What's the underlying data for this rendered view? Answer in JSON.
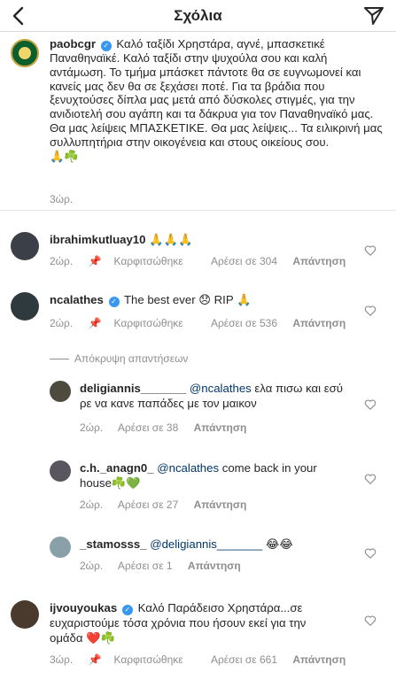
{
  "header": {
    "title": "Σχόλια",
    "back_icon": "chevron-left-icon",
    "send_icon": "paper-plane-icon"
  },
  "post": {
    "username": "paobcgr",
    "verified": true,
    "text": "Καλό ταξίδι Χρηστάρα, αγνέ, μπασκετικέ Παναθηναϊκέ. Καλό ταξίδι στην ψυχούλα σου και καλή αντάμωση. Το τμήμα μπάσκετ πάντοτε θα σε ευγνωμονεί και κανείς μας δεν θα σε ξεχάσει ποτέ. Για τα βράδια που ξενυχτούσες δίπλα μας μετά από δύσκολες στιγμές, για την ανιδιοτελή σου αγάπη και τα δάκρυα για τον Παναθηναϊκό μας. Θα μας λείψεις ΜΠΑΣΚΕΤΙΚΕ. Θα μας λείψεις... Τα ειλικρινή μας συλλυπητήρια στην οικογένεια και στους οικείους σου.",
    "emoji": "🙏☘️",
    "time": "3ώρ."
  },
  "comments": [
    {
      "username": "ibrahimkutluay10",
      "verified": false,
      "text": "🙏🙏🙏",
      "time": "2ώρ.",
      "pinned": "Καρφιτσώθηκε",
      "likes": "Αρέσει σε 304",
      "reply": "Απάντηση"
    },
    {
      "username": "ncalathes",
      "verified": true,
      "text": "The best ever 😞 RIP 🙏",
      "time": "2ώρ.",
      "pinned": "Καρφιτσώθηκε",
      "likes": "Αρέσει σε 536",
      "reply": "Απάντηση"
    },
    {
      "username": "ijvouyoukas",
      "verified": true,
      "text": "Καλό Παράδεισο Χρηστάρα...σε ευχαριστούμε τόσα χρόνια που ήσουν εκεί για την ομάδα ❤️☘️",
      "time": "3ώρ.",
      "pinned": "Καρφιτσώθηκε",
      "likes": "Αρέσει σε 661",
      "reply": "Απάντηση"
    }
  ],
  "hide_replies": "Απόκρυψη απαντήσεων",
  "replies": [
    {
      "username": "deligiannis_______",
      "mention": "@ncalathes",
      "text": "ελα πισω και εσύ ρε να κανε παπάδες με τον μαικον",
      "time": "2ώρ.",
      "likes": "Αρέσει σε 38",
      "reply": "Απάντηση"
    },
    {
      "username": "c.h._anagn0_",
      "mention": "@ncalathes",
      "text": "come back in your house☘️💚",
      "time": "2ώρ.",
      "likes": "Αρέσει σε 27",
      "reply": "Απάντηση"
    },
    {
      "username": "_stamosss_",
      "mention": "@deligiannis_______",
      "text": "😂😂",
      "time": "2ώρ.",
      "likes": "Αρέσει σε 1",
      "reply": "Απάντηση"
    }
  ],
  "icons": {
    "heart": "heart-outline-icon",
    "pin": "pin-icon"
  }
}
